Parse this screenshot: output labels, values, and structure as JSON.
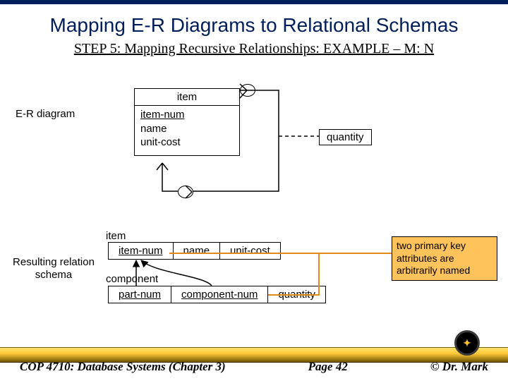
{
  "title": "Mapping E-R Diagrams to Relational Schemas",
  "subtitle": "STEP 5:  Mapping Recursive Relationships: EXAMPLE – M: N",
  "er": {
    "label": "E-R diagram",
    "entity": {
      "name": "item",
      "attrs": [
        "item-num",
        "name",
        "unit-cost"
      ],
      "pk_index": 0
    },
    "rel_attr": "quantity"
  },
  "schema": {
    "label": "Resulting relation schema",
    "tables": [
      {
        "name": "item",
        "cols": [
          "item-num",
          "name",
          "unit-cost"
        ],
        "pk": [
          0
        ]
      },
      {
        "name": "component",
        "cols": [
          "part-num",
          "component-num",
          "quantity"
        ],
        "pk": [
          0,
          1
        ]
      }
    ],
    "note": "two primary key attributes are arbitrarily named"
  },
  "footer": {
    "left": "COP 4710: Database Systems  (Chapter 3)",
    "center": "Page 42",
    "right": "© Dr. Mark"
  }
}
